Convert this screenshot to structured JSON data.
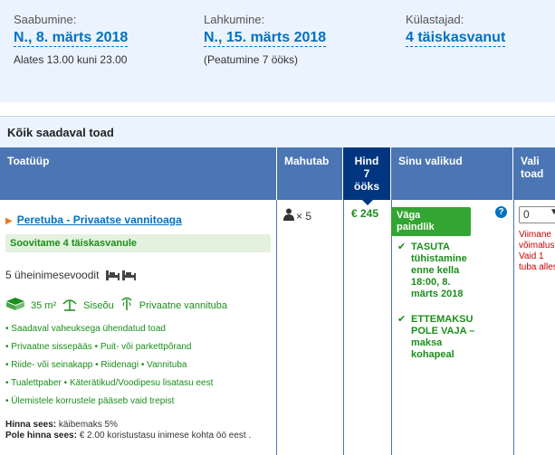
{
  "summary": {
    "checkin": {
      "label": "Saabumine:",
      "value": "N., 8. märts 2018",
      "sub": "Alates 13.00 kuni 23.00"
    },
    "checkout": {
      "label": "Lahkumine:",
      "value": "N., 15. märts 2018",
      "sub": "(Peatumine 7 ööks)"
    },
    "guests": {
      "label": "Külastajad:",
      "value": "4 täiskasvanut"
    }
  },
  "section_title": "Kõik saadaval toad",
  "table_header": {
    "room_type": "Toatüüp",
    "capacity": "Mahutab",
    "price_line1": "Hind",
    "price_line2": "7",
    "price_line3": "ööks",
    "choices": "Sinu valikud",
    "select_line1": "Vali",
    "select_line2": "toad"
  },
  "room": {
    "name": "Peretuba - Privaatse vannitoaga",
    "recommendation": "Soovitame 4 täiskasvanule",
    "beds": "5 üheinimesevoodit",
    "size": "35 m²",
    "toilet": "Siseõu",
    "bathroom": "Privaatne vannituba",
    "features": [
      "Saadaval vaheuksega ühendatud toad",
      "Privaatne sissepääs • Puit- või parkettpõrand",
      "Riide- või seinakapp • Riidenagi • Vannituba",
      "Tualettpaber • Käterätikud/Voodipesu lisatasu eest",
      "Ülemistele korrustele pääseb vaid trepist"
    ],
    "included_label": "Hinna sees:",
    "included_value": " käibemaks 5%",
    "not_included_label": "Pole hinna sees:",
    "not_included_value": " € 2.00 koristustasu inimese kohta öö eest .",
    "capacity_text": "× 5",
    "price": "€ 245",
    "badge_line1": "Väga",
    "badge_line2": "paindlik",
    "help_symbol": "?",
    "choice1": "TASUTA tühistamine enne kella 18:00, 8. märts 2018",
    "choice2": "ETTEMAKSU POLE VAJA – maksa kohapeal",
    "select_value": "0",
    "warn_line1": "Viimane",
    "warn_line2": "võimalus!",
    "warn_line3": "Vaid 1",
    "warn_line4": "tuba alles"
  },
  "colors": {
    "link": "#0071c2",
    "header": "#4b76b3",
    "price_header": "#003580",
    "green": "#1b8e1b",
    "badge": "#33a532",
    "summary_bg": "#ebf3ff"
  }
}
